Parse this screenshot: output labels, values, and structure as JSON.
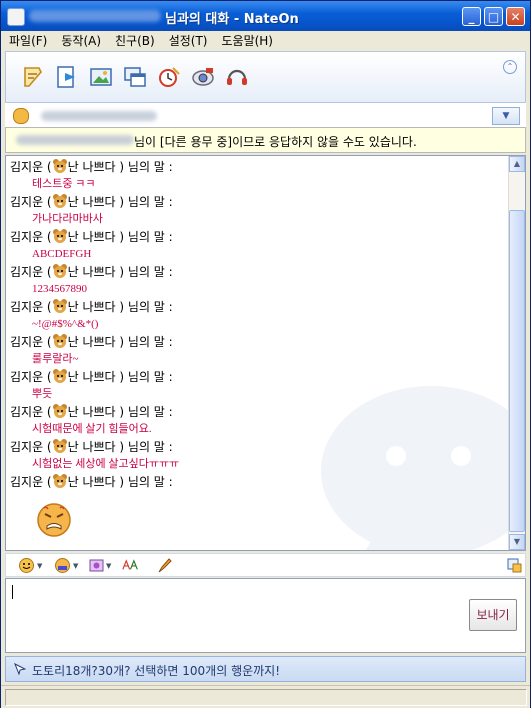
{
  "window": {
    "title": "님과의 대화  - NateOn",
    "controls": [
      "_",
      "□",
      "✕"
    ]
  },
  "menu": [
    "파일(F)",
    "동작(A)",
    "친구(B)",
    "설정(T)",
    "도움말(H)"
  ],
  "toolbar": {
    "icons": [
      "memo-icon",
      "file-send-icon",
      "picture-icon",
      "window-icon",
      "alarm-icon",
      "camera-icon",
      "headset-icon"
    ],
    "collapse": "⌃"
  },
  "notice": {
    "text": "님이 [다른 용무 중]이므로 응답하지 않을 수도 있습니다."
  },
  "chat": {
    "sender_name": "김지운 (",
    "sender_nick": "난 나쁘다 ) 님의 말 :",
    "messages": [
      "테스트중 ㅋㅋ",
      "가나다라마바사",
      "ABCDEFGH",
      "1234567890",
      "~!@#$%^&*()",
      "룰루랄라~",
      "뿌듯",
      "시험때문에 살기 힘들어요.",
      "시험없는 세상에 살고싶다ㅠㅠㅠ",
      ""
    ]
  },
  "input": {
    "send_label": "보내기"
  },
  "ad": {
    "text": "도토리18개?30개? 선택하면 100개의 행운까지!"
  },
  "colors": {
    "message_text": "#cc0044",
    "titlebar": "#0a5fd6"
  }
}
